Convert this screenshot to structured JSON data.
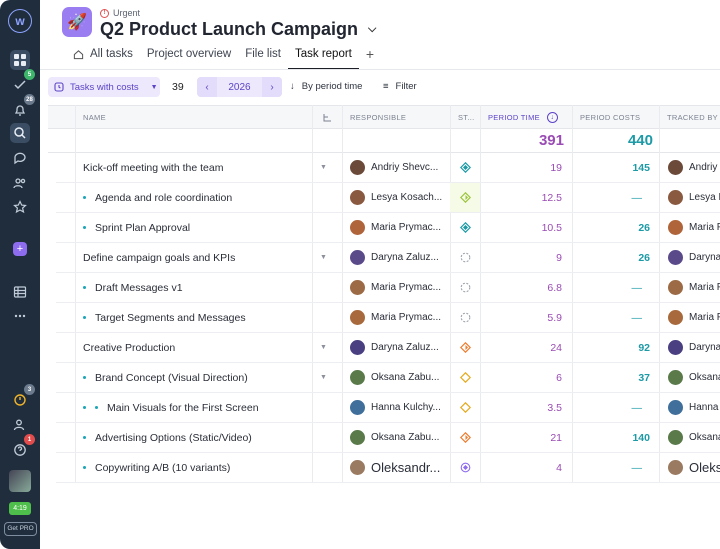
{
  "sidebar": {
    "logo": "w",
    "badges": {
      "tasks": "5",
      "notifications": "28",
      "timer": "3",
      "help": "1"
    },
    "timer_label": "4:19",
    "pro_label": "Get PRO"
  },
  "header": {
    "priority": "Urgent",
    "title": "Q2 Product Launch Campaign",
    "tabs": [
      "All tasks",
      "Project overview",
      "File list",
      "Task report"
    ],
    "active_tab": "Task report"
  },
  "toolbar": {
    "costs_toggle": "Tasks with costs",
    "count": "39",
    "year": "2026",
    "sort": "By period time",
    "filter": "Filter"
  },
  "columns": {
    "name": "NAME",
    "responsible": "RESPONSIBLE",
    "status": "ST...",
    "period_time": "PERIOD TIME",
    "period_costs": "PERIOD COSTS",
    "tracked_by": "TRACKED BY"
  },
  "totals": {
    "period_time": "391",
    "period_costs": "440"
  },
  "rows": [
    {
      "name": "Kick-off meeting with the team",
      "level": 0,
      "expand": true,
      "responsible": "Andriy Shevc...",
      "status": "in-review",
      "time": "19",
      "costs": "145",
      "tracked": "Andriy"
    },
    {
      "name": "Agenda and role coordination",
      "level": 1,
      "expand": false,
      "responsible": "Lesya Kosach...",
      "status": "approved",
      "time": "12.5",
      "costs": "—",
      "tracked": "Lesya K"
    },
    {
      "name": "Sprint Plan Approval",
      "level": 1,
      "expand": false,
      "responsible": "Maria Prymac...",
      "status": "in-review",
      "time": "10.5",
      "costs": "26",
      "tracked": "Maria P"
    },
    {
      "name": "Define campaign goals and KPIs",
      "level": 0,
      "expand": true,
      "responsible": "Daryna Zaluz...",
      "status": "open",
      "time": "9",
      "costs": "26",
      "tracked": "Daryna"
    },
    {
      "name": "Draft Messages v1",
      "level": 1,
      "expand": false,
      "responsible": "Maria Prymac...",
      "status": "open",
      "time": "6.8",
      "costs": "—",
      "tracked": "Maria P"
    },
    {
      "name": "Target Segments and Messages",
      "level": 1,
      "expand": false,
      "responsible": "Maria Prymac...",
      "status": "open",
      "time": "5.9",
      "costs": "—",
      "tracked": "Maria P"
    },
    {
      "name": "Creative Production",
      "level": 0,
      "expand": true,
      "responsible": "Daryna Zaluz...",
      "status": "in-progress",
      "time": "24",
      "costs": "92",
      "tracked": "Daryna"
    },
    {
      "name": "Brand Concept (Visual Direction)",
      "level": 1,
      "expand": true,
      "responsible": "Oksana Zabu...",
      "status": "to-do",
      "time": "6",
      "costs": "37",
      "tracked": "Oksana"
    },
    {
      "name": "Main Visuals for the First Screen",
      "level": 2,
      "expand": false,
      "responsible": "Hanna Kulchy...",
      "status": "to-do",
      "time": "3.5",
      "costs": "—",
      "tracked": "Hanna"
    },
    {
      "name": "Advertising Options (Static/Video)",
      "level": 1,
      "expand": false,
      "responsible": "Oksana Zabu...",
      "status": "in-progress",
      "time": "21",
      "costs": "140",
      "tracked": "Oksana"
    },
    {
      "name": "Copywriting A/B (10 variants)",
      "level": 1,
      "expand": false,
      "responsible": "Oleksandr...",
      "status": "done",
      "time": "4",
      "costs": "—",
      "tracked": "Oleks"
    }
  ],
  "colors": {
    "time": "#9a4bb4",
    "costs": "#1c9aa6",
    "accent": "#5d43c9"
  }
}
